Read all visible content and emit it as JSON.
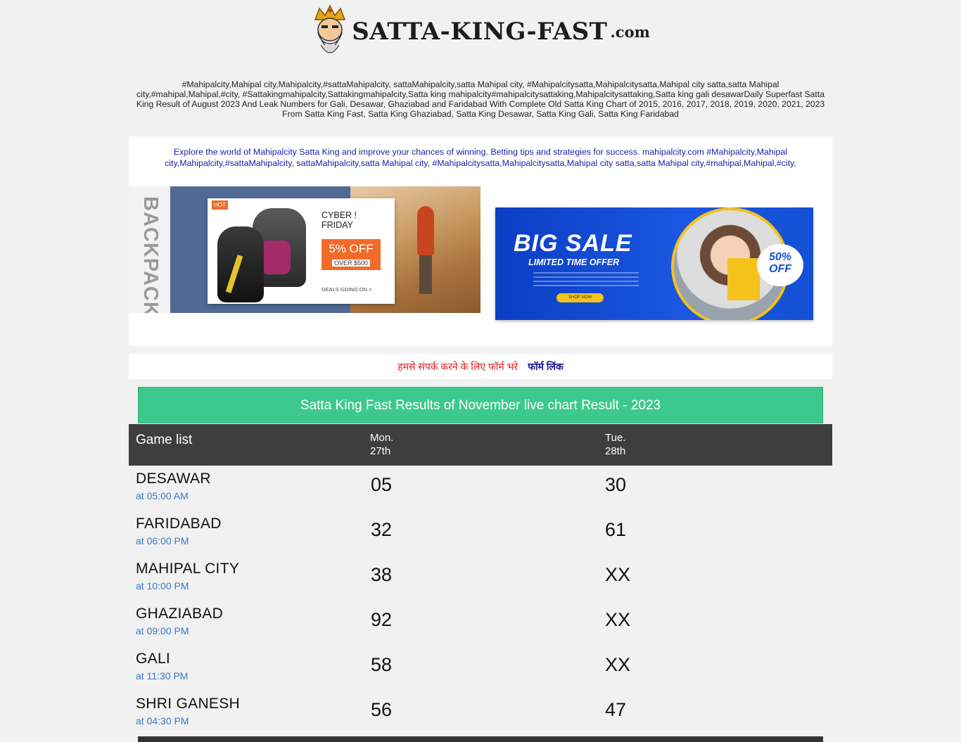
{
  "header": {
    "logo_text": "SATTA-KING-FAST",
    "logo_tld": ".com",
    "description": "#Mahipalcity,Mahipal city,Mahipalcity,#sattaMahipalcity, sattaMahipalcity,satta Mahipal city, #Mahipalcitysatta,Mahipalcitysatta,Mahipal city satta,satta Mahipal city,#mahipal,Mahipal,#city, #Sattakingmahipalcity,Sattakingmahipalcity,Satta king mahipalcity#mahipalcitysattaking,Mahipalcitysattaking,Satta king gali desawarDaily Superfast Satta King Result of August 2023 And Leak Numbers for Gali, Desawar, Ghaziabad and Faridabad With Complete Old Satta King Chart of 2015, 2016, 2017, 2018, 2019, 2020, 2021, 2023 From Satta King Fast, Satta King Ghaziabad, Satta King Desawar, Satta King Gali, Satta King Faridabad"
  },
  "explore": {
    "text": "Explore the world of Mahipalcity Satta King and improve your chances of winning. Betting tips and strategies for success. mahipalcity.com #Mahipalcity,Mahipal city,Mahipalcity,#sattaMahipalcity, sattaMahipalcity,satta Mahipal city, #Mahipalcitysatta,Mahipalcitysatta,Mahipal city satta,satta Mahipal city,#mahipal,Mahipal,#city,"
  },
  "ads": {
    "backpack": {
      "side_label": "BACKPACK",
      "hot": "HOT",
      "headline_1": "CYBER !",
      "headline_2": "FRIDAY",
      "discount": "5% OFF",
      "over": "OVER $500",
      "deals": "DEALS GOING ON >"
    },
    "sale": {
      "title": "BIG SALE",
      "subtitle": "LIMITED TIME OFFER",
      "button": "SHOP NOW",
      "badge_1": "50%",
      "badge_2": "OFF"
    }
  },
  "contact": {
    "text": "हमसे संपर्क करने के लिए फॉर्म भरे",
    "link": "फॉर्म लिंक"
  },
  "results": {
    "title": "Satta King Fast Results of November live chart Result - 2023",
    "col_game": "Game list",
    "day1": "Mon.",
    "date1": "27th",
    "day2": "Tue.",
    "date2": "28th",
    "rows": [
      {
        "name": "DESAWAR",
        "time": "at 05:00 AM",
        "v1": "05",
        "v2": "30"
      },
      {
        "name": "FARIDABAD",
        "time": "at 06:00 PM",
        "v1": "32",
        "v2": "61"
      },
      {
        "name": "MAHIPAL CITY",
        "time": "at 10:00 PM",
        "v1": "38",
        "v2": "XX"
      },
      {
        "name": "GHAZIABAD",
        "time": "at 09:00 PM",
        "v1": "92",
        "v2": "XX"
      },
      {
        "name": "GALI",
        "time": "at 11:30 PM",
        "v1": "58",
        "v2": "XX"
      },
      {
        "name": "SHRI GANESH",
        "time": "at 04:30 PM",
        "v1": "56",
        "v2": "47"
      }
    ]
  }
}
